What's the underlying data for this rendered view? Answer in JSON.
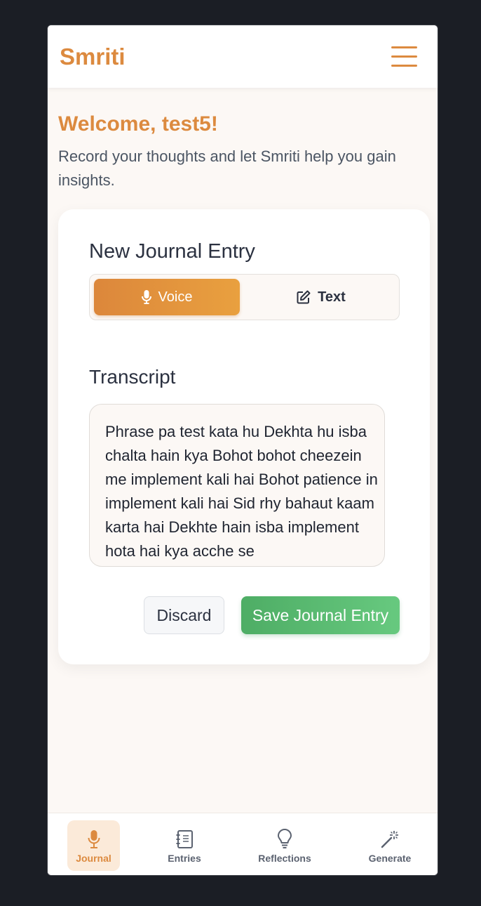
{
  "app": {
    "brand": "Smriti"
  },
  "welcome": {
    "title": "Welcome, test5!",
    "subtitle": "Record your thoughts and let Smriti help you gain insights."
  },
  "entry": {
    "title": "New Journal Entry",
    "mode_voice": "Voice",
    "mode_text": "Text",
    "selected_mode": "Voice",
    "transcript_heading": "Transcript",
    "transcript": "Phrase pa test kata hu Dekhta hu isba chalta hain kya Bohot bohot cheezein me implement kali hai Bohot patience in implement kali hai Sid rhy bahaut kaam karta hai Dekhte hain isba implement hota hai kya acche se",
    "discard_label": "Discard",
    "save_label": "Save Journal Entry"
  },
  "nav": {
    "items": [
      {
        "label": "Journal",
        "icon": "microphone-icon",
        "active": true
      },
      {
        "label": "Entries",
        "icon": "notebook-icon",
        "active": false
      },
      {
        "label": "Reflections",
        "icon": "lightbulb-icon",
        "active": false
      },
      {
        "label": "Generate",
        "icon": "magic-wand-icon",
        "active": false
      }
    ]
  },
  "colors": {
    "accent": "#dc8a3f",
    "save_green": "#5cbb73",
    "background": "#fcf8f5",
    "text_dark": "#2b3140"
  }
}
